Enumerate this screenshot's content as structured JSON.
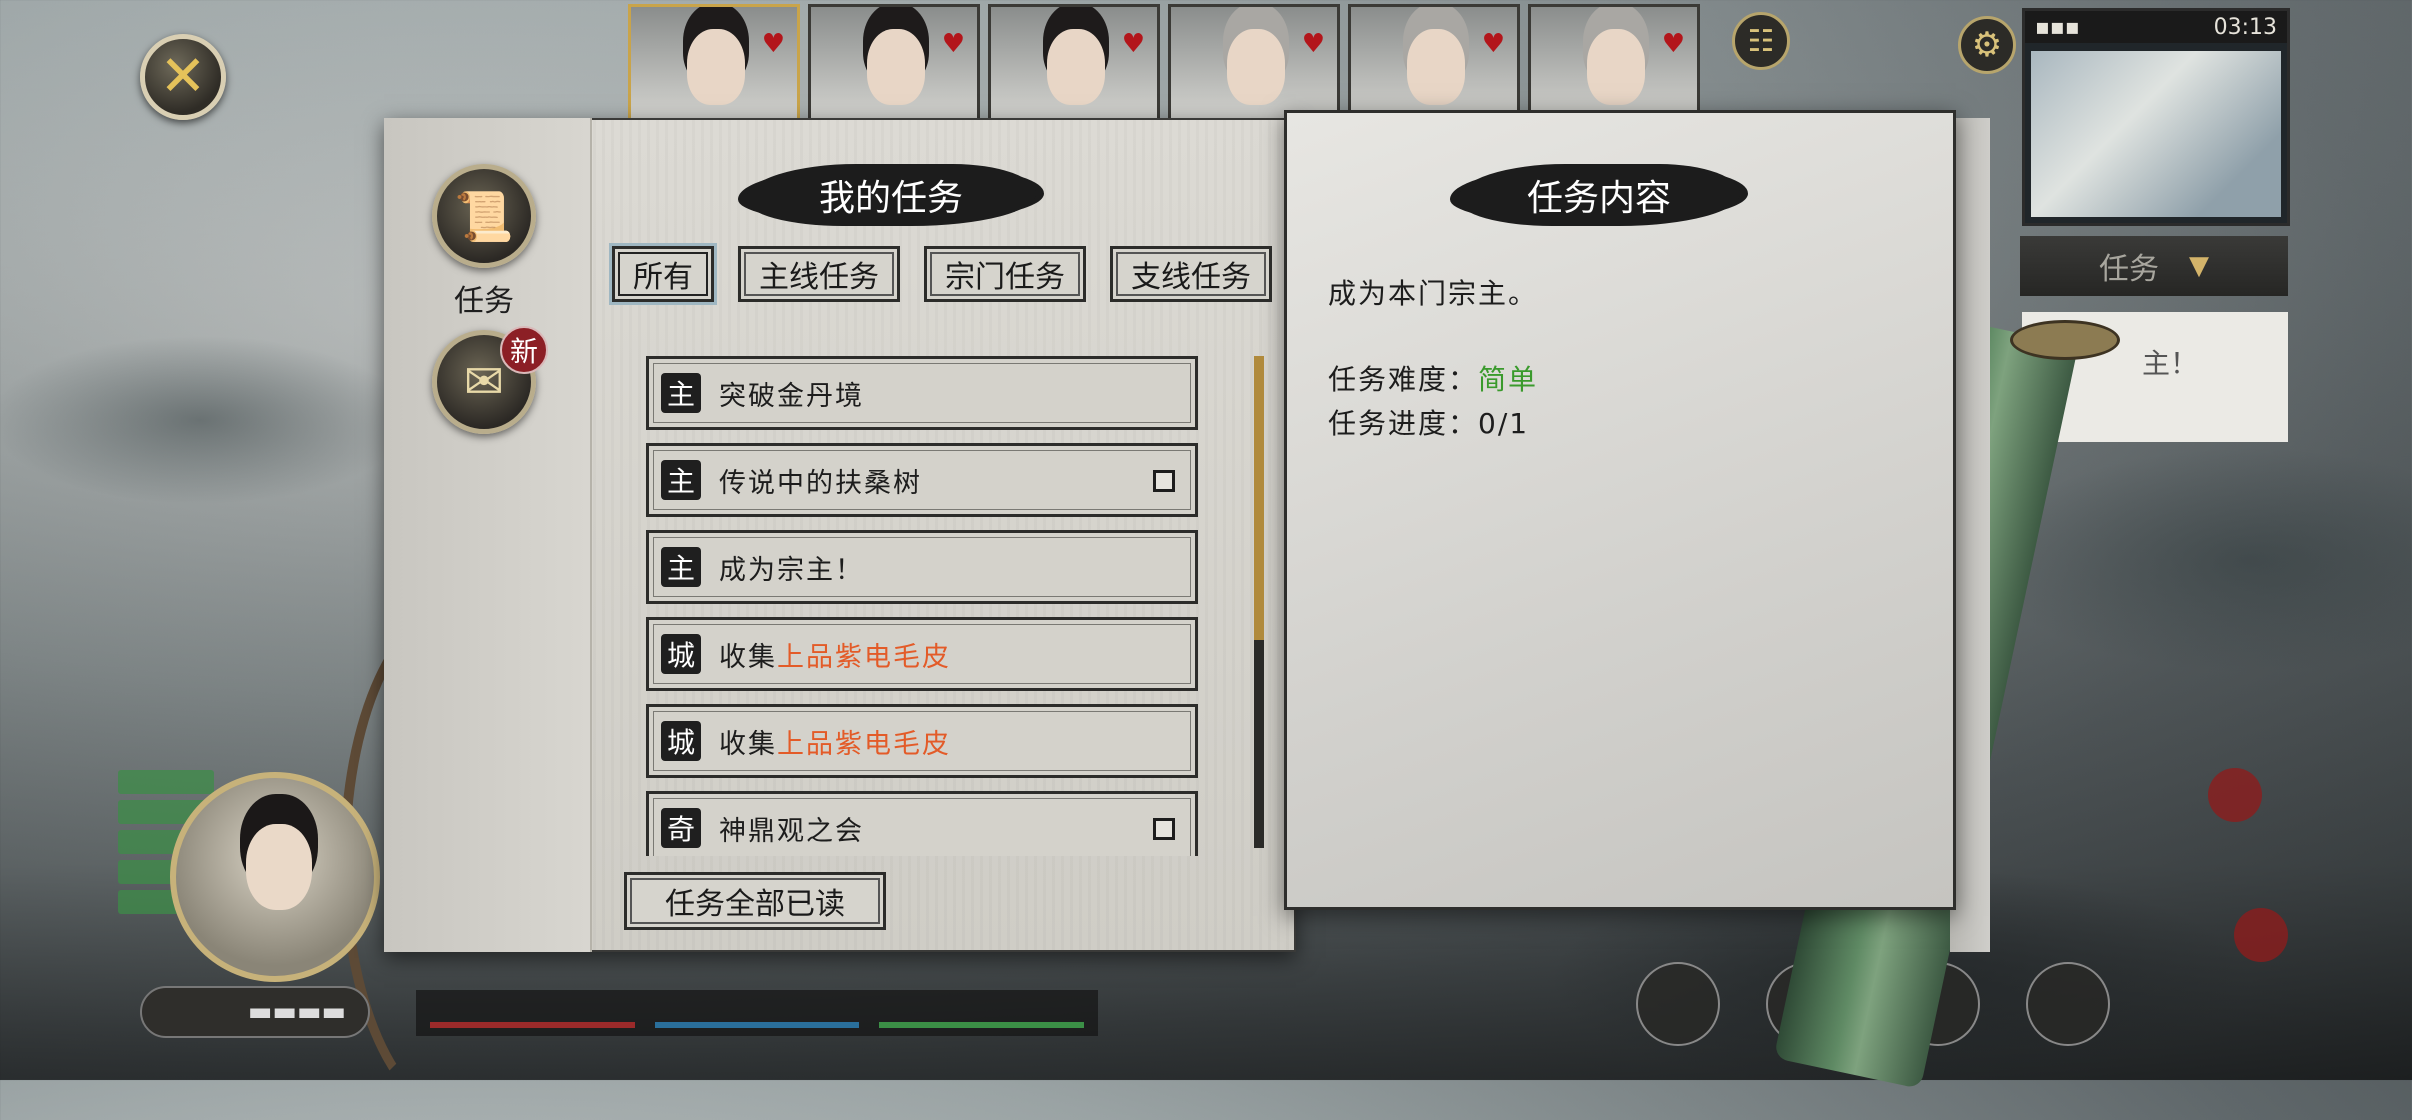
{
  "top": {
    "clock": "03:13",
    "portraits": [
      {
        "selected": true,
        "hair": "dark"
      },
      {
        "selected": false,
        "hair": "dark"
      },
      {
        "selected": false,
        "hair": "dark"
      },
      {
        "selected": false,
        "hair": "gray"
      },
      {
        "selected": false,
        "hair": "gray"
      },
      {
        "selected": false,
        "hair": "gray"
      }
    ]
  },
  "hud": {
    "quest_dropdown": "任务",
    "side_note": "主！"
  },
  "panel": {
    "side_tabs": {
      "tasks_label": "任务",
      "new_badge": "新"
    },
    "list_title": "我的任务",
    "tabs": [
      {
        "label": "所有",
        "active": true
      },
      {
        "label": "主线任务",
        "active": false
      },
      {
        "label": "宗门任务",
        "active": false
      },
      {
        "label": "支线任务",
        "active": false
      }
    ],
    "quests": [
      {
        "type": "主",
        "name": "突破金丹境",
        "highlight": "",
        "checkbox": false
      },
      {
        "type": "主",
        "name": "传说中的扶桑树",
        "highlight": "",
        "checkbox": true
      },
      {
        "type": "主",
        "name": "成为宗主！",
        "highlight": "",
        "checkbox": false
      },
      {
        "type": "城",
        "name": "收集",
        "highlight": "上品紫电毛皮",
        "checkbox": false
      },
      {
        "type": "城",
        "name": "收集",
        "highlight": "上品紫电毛皮",
        "checkbox": false
      },
      {
        "type": "奇",
        "name": "神鼎观之会",
        "highlight": "",
        "checkbox": true
      }
    ],
    "read_all_button": "任务全部已读",
    "detail_title": "任务内容",
    "detail": {
      "description": "成为本门宗主。",
      "difficulty_label": "任务难度：",
      "difficulty_value": "简单",
      "progress_label": "任务进度：",
      "progress_value": "0/1"
    }
  },
  "colors": {
    "highlight_orange": "#e35b28",
    "difficulty_green": "#3a9a2c",
    "scroll_thumb": "#b08a3c",
    "heart_red": "#b3161b"
  },
  "icons": {
    "close": "close-icon",
    "heart": "heart-icon",
    "people": "people-icon",
    "gear": "gear-icon",
    "scroll": "scroll-icon",
    "letter": "letter-icon"
  }
}
